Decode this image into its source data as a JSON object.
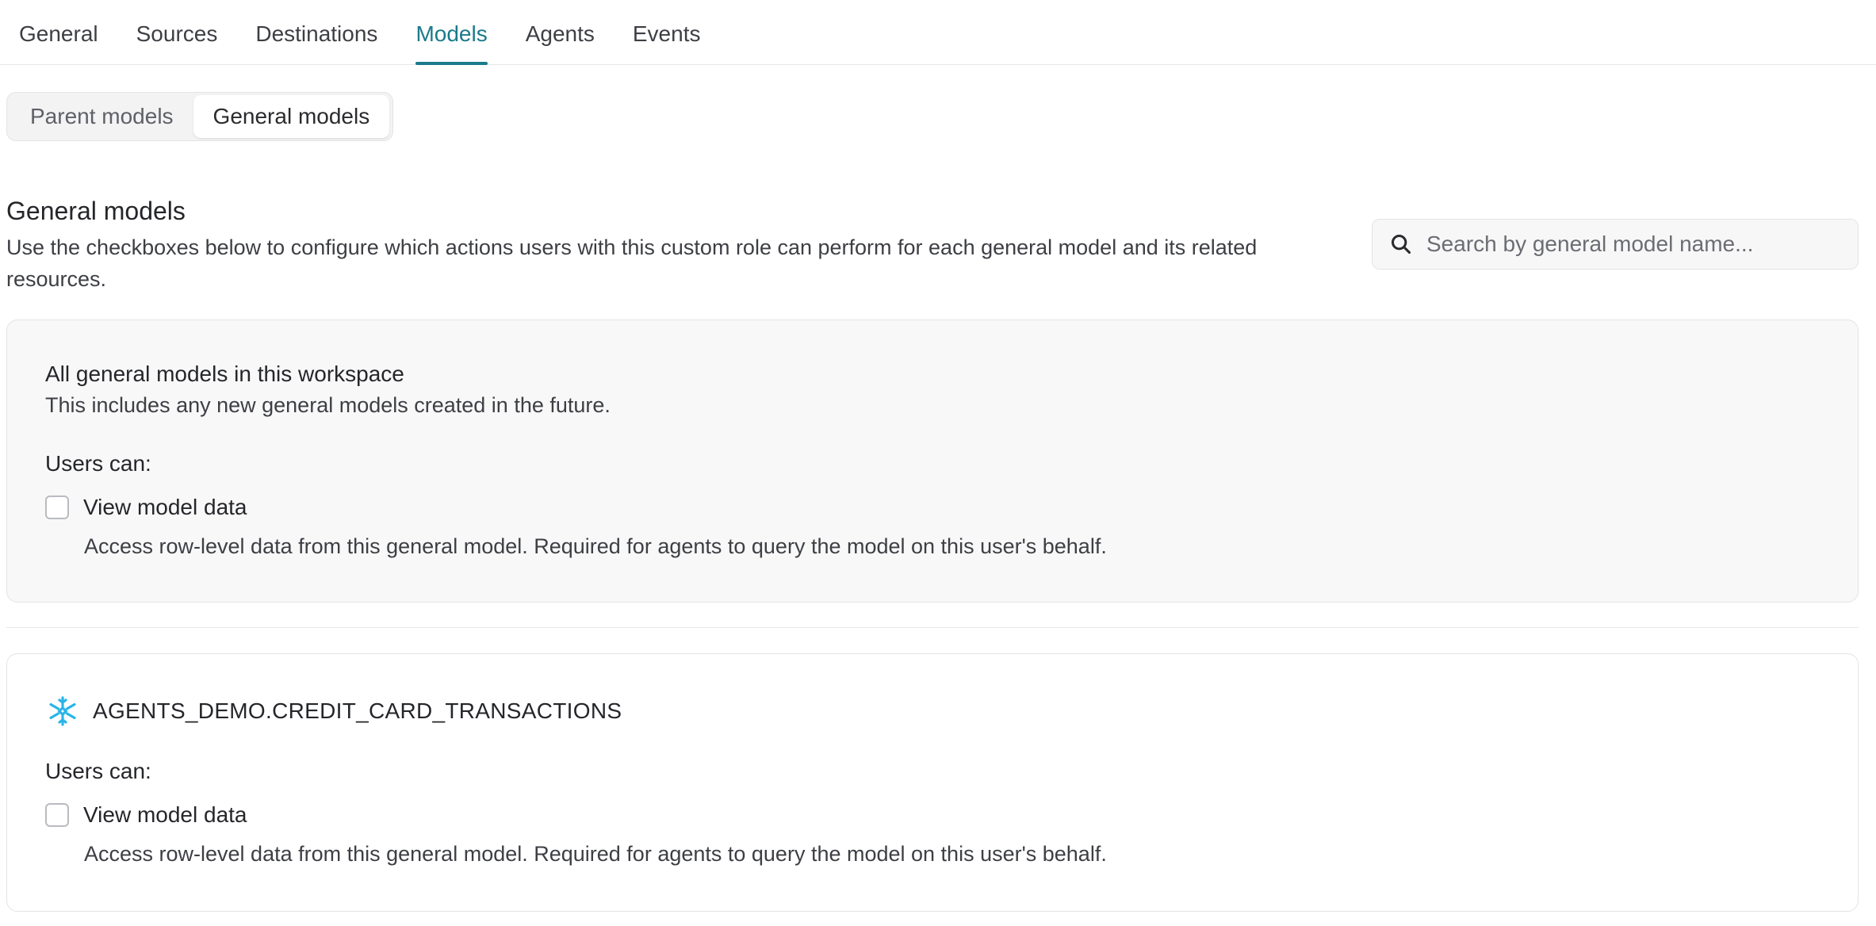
{
  "tabs": [
    {
      "label": "General",
      "active": false
    },
    {
      "label": "Sources",
      "active": false
    },
    {
      "label": "Destinations",
      "active": false
    },
    {
      "label": "Models",
      "active": true
    },
    {
      "label": "Agents",
      "active": false
    },
    {
      "label": "Events",
      "active": false
    }
  ],
  "segment": {
    "options": [
      "Parent models",
      "General models"
    ],
    "selected": "General models"
  },
  "section": {
    "title": "General models",
    "description": "Use the checkboxes below to configure which actions users with this custom role can perform for each general model and its related resources."
  },
  "search": {
    "placeholder": "Search by general model name...",
    "value": "",
    "icon": "search-icon"
  },
  "all_models_card": {
    "title": "All general models in this workspace",
    "subtitle": "This includes any new general models created in the future.",
    "users_can": "Users can:",
    "permission": {
      "label": "View model data",
      "description": "Access row-level data from this general model. Required for agents to query the model on this user's behalf.",
      "checked": false
    }
  },
  "model_card": {
    "icon": "snowflake-icon",
    "name": "AGENTS_DEMO.CREDIT_CARD_TRANSACTIONS",
    "users_can": "Users can:",
    "permission": {
      "label": "View model data",
      "description": "Access row-level data from this general model. Required for agents to query the model on this user's behalf.",
      "checked": false
    }
  },
  "colors": {
    "accent": "#1a7a8a",
    "snowflake": "#29b5e8"
  }
}
